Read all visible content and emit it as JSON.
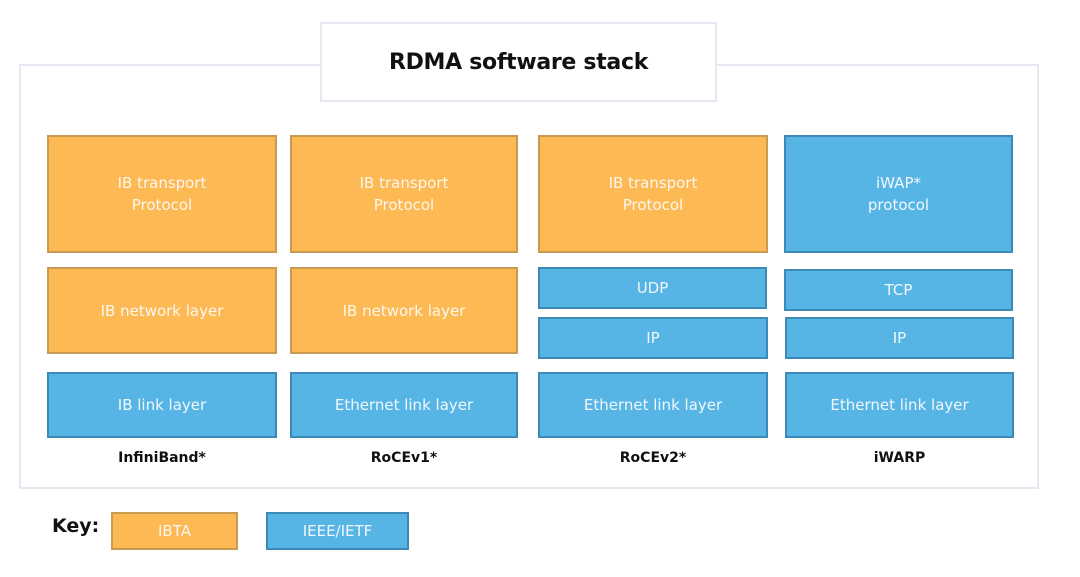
{
  "title": "RDMA software stack",
  "colors": {
    "ibta": "#fdb954",
    "ieee_ietf": "#57b5e6"
  },
  "columns": [
    {
      "name": "InfiniBand*",
      "layers": [
        {
          "label": "IB transport\nProtocol",
          "standard": "IBTA"
        },
        {
          "label": "IB network layer",
          "standard": "IBTA"
        },
        {
          "label": "IB link layer",
          "standard": "IEEE/IETF"
        }
      ]
    },
    {
      "name": "RoCEv1*",
      "layers": [
        {
          "label": "IB transport\nProtocol",
          "standard": "IBTA"
        },
        {
          "label": "IB network layer",
          "standard": "IBTA"
        },
        {
          "label": "Ethernet link layer",
          "standard": "IEEE/IETF"
        }
      ]
    },
    {
      "name": "RoCEv2*",
      "layers": [
        {
          "label": "IB transport\nProtocol",
          "standard": "IBTA"
        },
        {
          "label": "UDP",
          "standard": "IEEE/IETF"
        },
        {
          "label": "IP",
          "standard": "IEEE/IETF"
        },
        {
          "label": "Ethernet link layer",
          "standard": "IEEE/IETF"
        }
      ]
    },
    {
      "name": "iWARP",
      "layers": [
        {
          "label": "iWAP*\nprotocol",
          "standard": "IEEE/IETF"
        },
        {
          "label": "TCP",
          "standard": "IEEE/IETF"
        },
        {
          "label": "IP",
          "standard": "IEEE/IETF"
        },
        {
          "label": "Ethernet link layer",
          "standard": "IEEE/IETF"
        }
      ]
    }
  ],
  "key": {
    "label": "Key:",
    "items": [
      {
        "label": "IBTA",
        "standard": "IBTA"
      },
      {
        "label": "IEEE/IETF",
        "standard": "IEEE/IETF"
      }
    ]
  }
}
